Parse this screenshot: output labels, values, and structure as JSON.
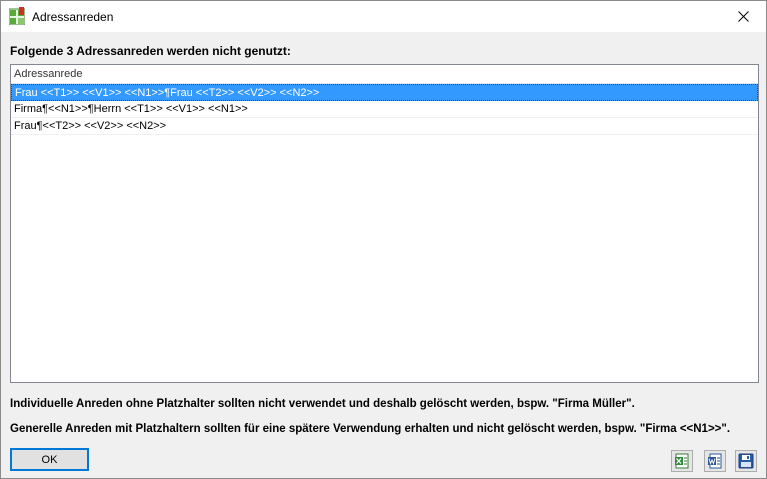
{
  "window": {
    "title": "Adressanreden",
    "app_icon": "green-grid-app-icon",
    "close_icon": "close-icon"
  },
  "heading": "Folgende 3 Adressanreden werden nicht genutzt:",
  "list": {
    "column_header": "Adressanrede",
    "rows": [
      {
        "text": "Frau <<T1>> <<V1>> <<N1>>¶Frau <<T2>> <<V2>> <<N2>>",
        "selected": true
      },
      {
        "text": "Firma¶<<N1>>¶Herrn <<T1>> <<V1>> <<N1>>",
        "selected": false
      },
      {
        "text": "Frau¶<<T2>> <<V2>> <<N2>>",
        "selected": false
      }
    ]
  },
  "notes": {
    "individual": "Individuelle Anreden ohne Platzhalter sollten nicht verwendet und deshalb gelöscht werden, bspw. \"Firma Müller\".",
    "general": "Generelle Anreden mit Platzhaltern sollten für eine spätere Verwendung erhalten und nicht gelöscht werden, bspw. \"Firma <<N1>>\"."
  },
  "buttons": {
    "ok_label": "OK",
    "excel_icon": "excel-export-icon",
    "word_icon": "word-export-icon",
    "save_icon": "save-icon"
  },
  "colors": {
    "selection": "#3399ff",
    "ok_border": "#0078d7"
  }
}
